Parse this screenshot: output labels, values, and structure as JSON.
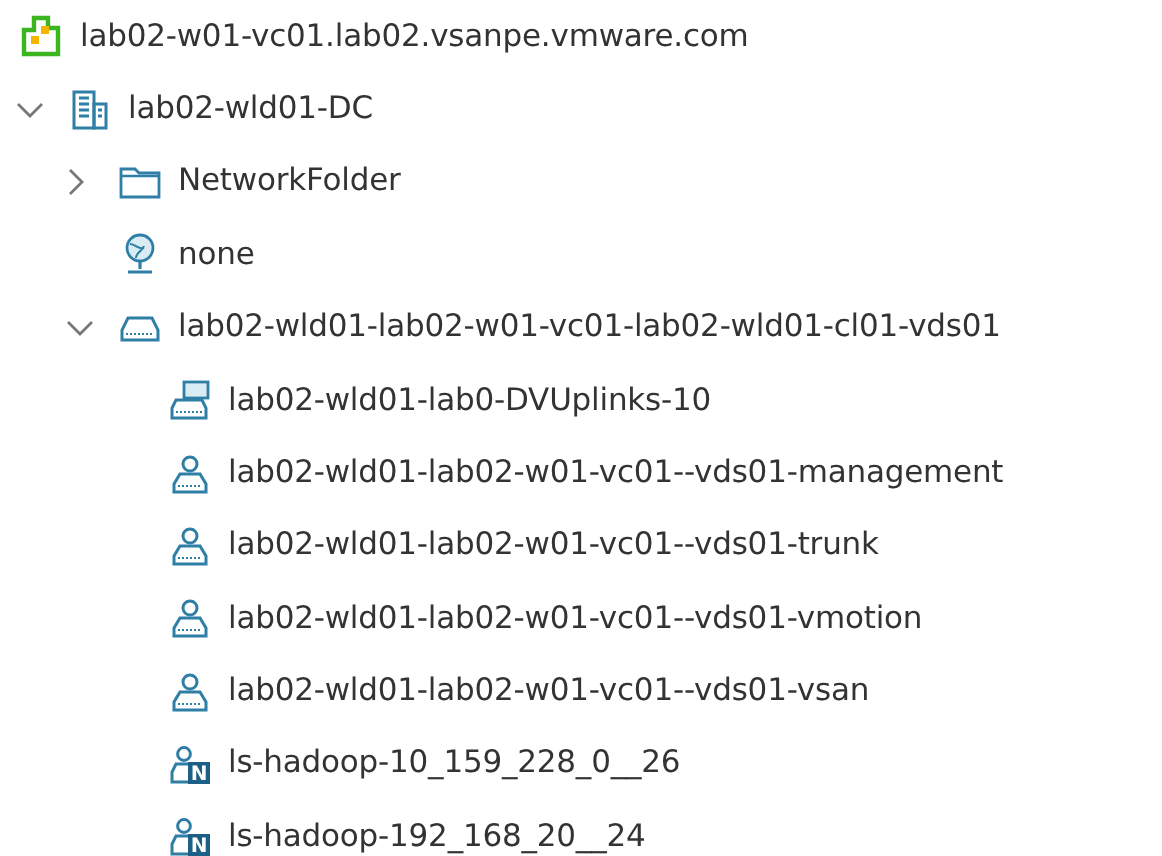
{
  "tree": [
    {
      "label": "lab02-w01-vc01.lab02.vsanpe.vmware.com",
      "kind": "vcenter",
      "children": [
        {
          "label": "lab02-wld01-DC",
          "kind": "datacenter",
          "expanded": true,
          "children": [
            {
              "label": "NetworkFolder",
              "kind": "folder",
              "expanded": false
            },
            {
              "label": "none",
              "kind": "network"
            },
            {
              "label": "lab02-wld01-lab02-w01-vc01-lab02-wld01-cl01-vds01",
              "kind": "vds",
              "expanded": true,
              "children": [
                {
                  "label": "lab02-wld01-lab0-DVUplinks-10",
                  "kind": "uplink"
                },
                {
                  "label": "lab02-wld01-lab02-w01-vc01--vds01-management",
                  "kind": "portgroup"
                },
                {
                  "label": "lab02-wld01-lab02-w01-vc01--vds01-trunk",
                  "kind": "portgroup"
                },
                {
                  "label": "lab02-wld01-lab02-w01-vc01--vds01-vmotion",
                  "kind": "portgroup"
                },
                {
                  "label": "lab02-wld01-lab02-w01-vc01--vds01-vsan",
                  "kind": "portgroup"
                },
                {
                  "label": "ls-hadoop-10_159_228_0__26",
                  "kind": "nsx-portgroup",
                  "badge": "N"
                },
                {
                  "label": "ls-hadoop-192_168_20__24",
                  "kind": "nsx-portgroup",
                  "badge": "N"
                }
              ]
            }
          ]
        }
      ]
    }
  ]
}
